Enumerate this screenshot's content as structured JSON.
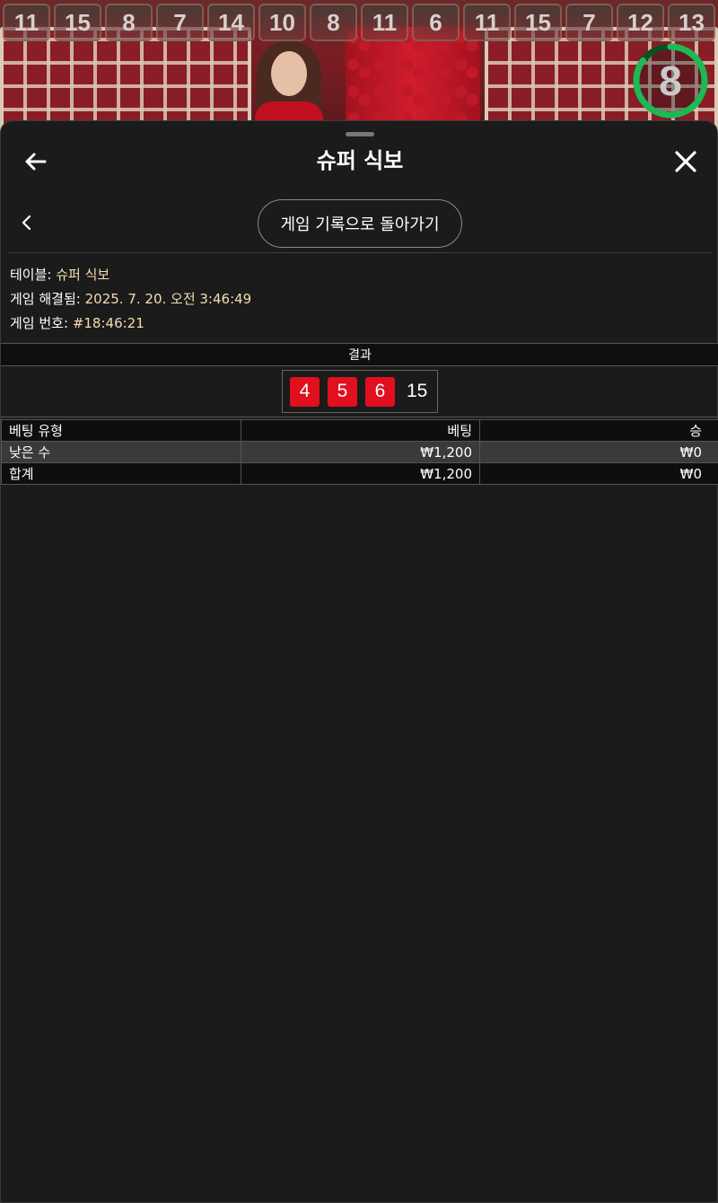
{
  "history": [
    "11",
    "15",
    "8",
    "7",
    "14",
    "10",
    "8",
    "11",
    "6",
    "11",
    "15",
    "7",
    "12",
    "13"
  ],
  "timer": {
    "value": "8",
    "progress": 0.85,
    "color": "#1db954"
  },
  "header": {
    "title": "슈퍼 식보",
    "back_icon": "arrow-left-icon",
    "close_icon": "close-icon"
  },
  "nav": {
    "return_label": "게임 기록으로 돌아가기"
  },
  "info": {
    "table_label": "테이블:",
    "table_value": "슈퍼 식보",
    "resolved_label": "게임 해결됨:",
    "resolved_value": "2025. 7. 20. 오전 3:46:49",
    "number_label": "게임 번호:",
    "number_value": "#18:46:21"
  },
  "result": {
    "header": "결과",
    "dice": [
      "4",
      "5",
      "6"
    ],
    "total": "15",
    "die_color": "#e0101e"
  },
  "bets": {
    "columns": [
      "베팅 유형",
      "베팅",
      "승"
    ],
    "rows": [
      {
        "type": "낮은 수",
        "bet": "₩1,200",
        "win": "₩0"
      },
      {
        "type": "합계",
        "bet": "₩1,200",
        "win": "₩0"
      }
    ]
  }
}
